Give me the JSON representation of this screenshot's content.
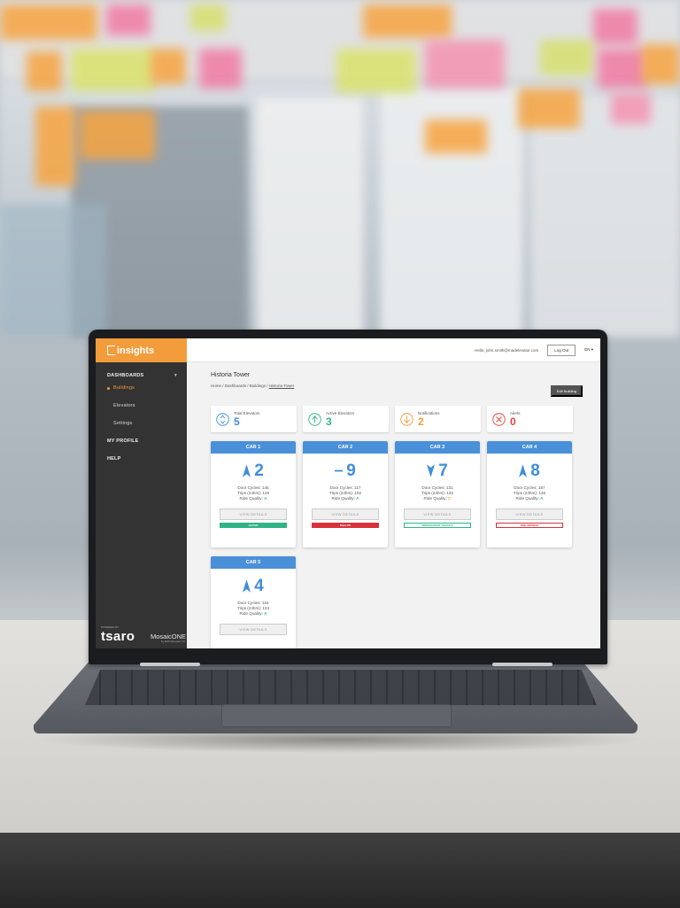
{
  "app": {
    "logo_text": "insights",
    "sidebar": {
      "items": [
        {
          "label": "DASHBOARDS",
          "type": "head"
        },
        {
          "label": "Buildings",
          "type": "sub-active"
        },
        {
          "label": "Elevators",
          "type": "sub"
        },
        {
          "label": "Settings",
          "type": "sub"
        },
        {
          "label": "MY PROFILE",
          "type": "head"
        },
        {
          "label": "HELP",
          "type": "head"
        }
      ],
      "powered_by": "POWERED BY",
      "brand": "tsaro",
      "partner": "MosaicONE",
      "partner_sub": "by MAD Elevator Inc."
    },
    "topbar": {
      "greeting": "Hello, john.smith@madelevator.com",
      "logout_label": "Log Out",
      "language": "EN ▾"
    },
    "page": {
      "title": "Historia Tower",
      "breadcrumb_prefix": "Home / Dashboards / Buildings / ",
      "breadcrumb_current": "Historia Tower",
      "edit_label": "Edit Building"
    },
    "stats": [
      {
        "label": "Total Elevators",
        "value": "5",
        "icon": "elevator-icon",
        "color": "#3f8ed8"
      },
      {
        "label": "Active Elevators",
        "value": "3",
        "icon": "active-arrow-icon",
        "color": "#2fb387"
      },
      {
        "label": "Notifications",
        "value": "2",
        "icon": "notification-arrow-icon",
        "color": "#f39c3c"
      },
      {
        "label": "Alerts",
        "value": "0",
        "icon": "alert-x-icon",
        "color": "#e2453c"
      }
    ],
    "cars": [
      {
        "name": "CAR 1",
        "direction": "up",
        "floor": "2",
        "door_cycles": "Door Cycles: 145",
        "trips": "Trips (24hrs): 126",
        "ride_quality_label": "Ride Quality: ",
        "grade": "A",
        "grade_color": "#2fb387",
        "view_label": "VIEW DETAILS",
        "status": "ACTIVE",
        "status_style": "filled",
        "status_color": "#2fb387"
      },
      {
        "name": "CAR 2",
        "direction": "idle",
        "floor": "9",
        "door_cycles": "Door Cycles: 117",
        "trips": "Trips (24hrs): 102",
        "ride_quality_label": "Ride Quality: ",
        "grade": "A",
        "grade_color": "#2fb387",
        "view_label": "VIEW DETAILS",
        "status": "Main Off",
        "status_style": "filled",
        "status_color": "#d8313a"
      },
      {
        "name": "CAR 3",
        "direction": "down",
        "floor": "7",
        "door_cycles": "Door Cycles: 131",
        "trips": "Trips (24hrs): 120",
        "ride_quality_label": "Ride Quality: ",
        "grade": "C",
        "grade_color": "#f39c3c",
        "view_label": "VIEW DETAILS",
        "status": "INDEPENDENT SERVICE",
        "status_style": "outline",
        "status_color": "#2fb387"
      },
      {
        "name": "CAR 4",
        "direction": "up",
        "floor": "8",
        "door_cycles": "Door Cycles: 157",
        "trips": "Trips (24hrs): 145",
        "ride_quality_label": "Ride Quality: ",
        "grade": "A",
        "grade_color": "#2fb387",
        "view_label": "VIEW DETAILS",
        "status": "FIRE SERVICE",
        "status_style": "outline",
        "status_color": "#d8313a"
      },
      {
        "name": "CAR 5",
        "direction": "up",
        "floor": "4",
        "door_cycles": "Door Cycles: 154",
        "trips": "Trips (24hrs): 134",
        "ride_quality_label": "Ride Quality: ",
        "grade": "A",
        "grade_color": "#2fb387",
        "view_label": "VIEW DETAILS",
        "status": "",
        "status_style": "none",
        "status_color": "#2fb387"
      }
    ]
  }
}
